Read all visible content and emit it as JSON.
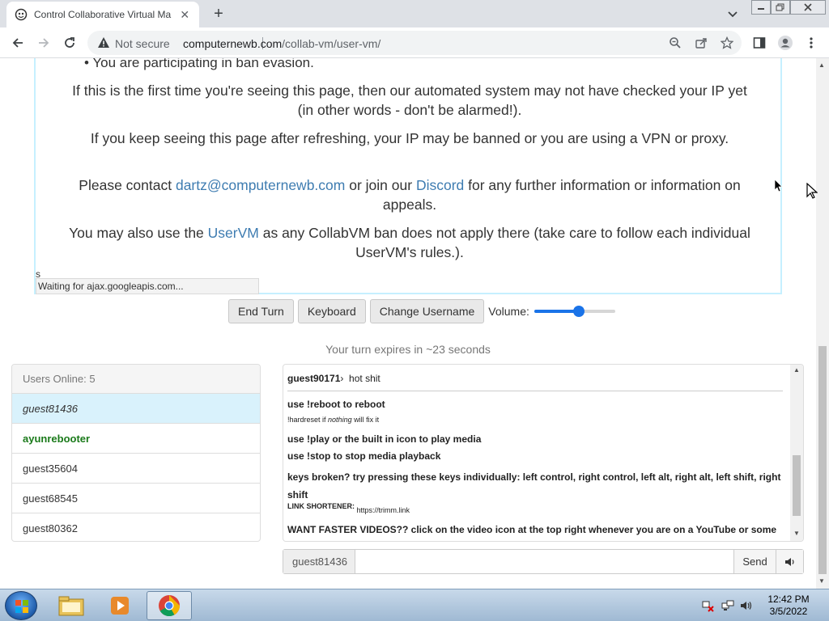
{
  "browser": {
    "tab_title": "Control Collaborative Virtual Ma",
    "not_secure": "Not secure",
    "url_host": "computernewb.com",
    "url_path": "/collab-vm/user-vm/"
  },
  "ban": {
    "bullet": "You are participating in ban evasion.",
    "p1": "If this is the first time you're seeing this page, then our automated system may not have checked your IP yet (in other words - don't be alarmed!).",
    "p2": "If you keep seeing this page after refreshing, your IP may be banned or you are using a VPN or proxy.",
    "p3_pre": "Please contact",
    "p3_email": "dartz@computernewb.com",
    "p3_mid": "or join our",
    "p3_discord": "Discord",
    "p3_post": "for any further information or information on appeals.",
    "p4_pre": "You may also use the",
    "p4_link": "UserVM",
    "p4_post": "as any CollabVM ban does not apply there (take care to follow each individual UserVM's rules.).",
    "stray": "s",
    "status": "Waiting for ajax.googleapis.com..."
  },
  "controls": {
    "end_turn": "End Turn",
    "keyboard": "Keyboard",
    "change_username": "Change Username",
    "volume_label": "Volume:",
    "volume_level": 0.56
  },
  "turn_text": "Your turn expires in ~23 seconds",
  "users": {
    "header": "Users Online: 5",
    "list": [
      "guest81436",
      "ayunrebooter",
      "guest35604",
      "guest68545",
      "guest80362"
    ]
  },
  "chat": {
    "m1_user": "guest90171",
    "m1_sep": "›",
    "m1_text": "hot shit",
    "m2": "use !reboot to reboot",
    "m3_pre": "!hardreset if",
    "m3_em": "nothing",
    "m3_post": "will fix it",
    "m4": "use !play or the built in icon to play media",
    "m5": "use !stop to stop media playback",
    "m6": "keys broken? try pressing these keys individually: left control, right control, left alt, right alt, left shift, right shift",
    "m7_label": "LINK SHORTENER:",
    "m7_link": "https://trimm.link",
    "m8": "WANT FASTER VIDEOS?? click on the video icon at the top right whenever you are on a YouTube or some other video l",
    "username": "guest81436",
    "send": "Send"
  },
  "taskbar": {
    "time": "12:42 PM",
    "date": "3/5/2022"
  },
  "colors": {
    "link": "#3e7cb1",
    "accent": "#1a73e8",
    "admin": "#1a7a1a"
  }
}
